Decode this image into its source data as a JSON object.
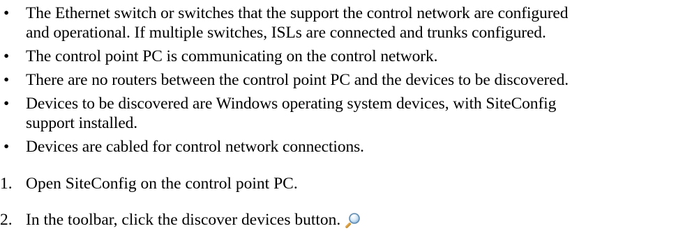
{
  "bullets": [
    {
      "symbol": "•",
      "lines": [
        "The Ethernet switch or switches that the support the control network are configured",
        "and operational. If multiple switches, ISLs are connected and trunks configured."
      ]
    },
    {
      "symbol": "•",
      "lines": [
        "The control point PC is communicating on the control network."
      ]
    },
    {
      "symbol": "•",
      "lines": [
        "There are no routers between the control point PC and the devices to be discovered."
      ]
    },
    {
      "symbol": "•",
      "lines": [
        "Devices to be discovered are Windows operating system devices, with SiteConfig",
        "support installed."
      ]
    },
    {
      "symbol": "•",
      "lines": [
        "Devices are cabled for control network connections."
      ]
    }
  ],
  "steps": [
    {
      "number": "1.",
      "text": "Open SiteConfig on the control point PC."
    },
    {
      "number": "2.",
      "text": "In the toolbar, click the discover devices button.",
      "icon": "magnifier-icon"
    }
  ]
}
